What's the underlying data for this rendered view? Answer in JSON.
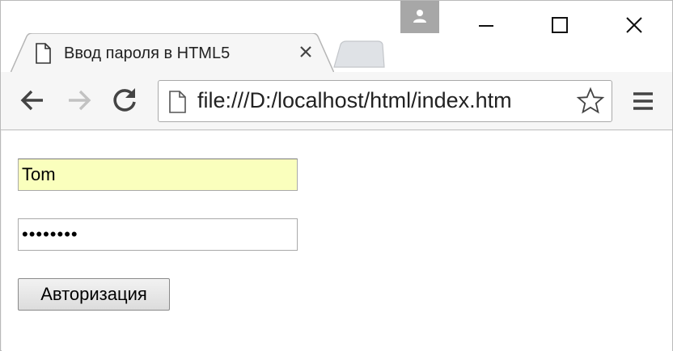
{
  "tab": {
    "title": "Ввод пароля в HTML5"
  },
  "toolbar": {
    "url": "file:///D:/localhost/html/index.htm"
  },
  "form": {
    "login_value": "Tom",
    "password_value": "password",
    "submit_label": "Авторизация"
  },
  "icons": {
    "profile": "profile-icon",
    "minimize": "minimize-icon",
    "maximize": "maximize-icon",
    "close": "close-icon",
    "tab_page": "page-icon",
    "tab_close": "close-icon",
    "back": "back-arrow-icon",
    "forward": "forward-arrow-icon",
    "reload": "reload-icon",
    "bookmark": "star-icon",
    "menu": "hamburger-menu-icon"
  },
  "colors": {
    "autofill_background": "#faffbd",
    "profile_button": "#a7a7a7"
  }
}
